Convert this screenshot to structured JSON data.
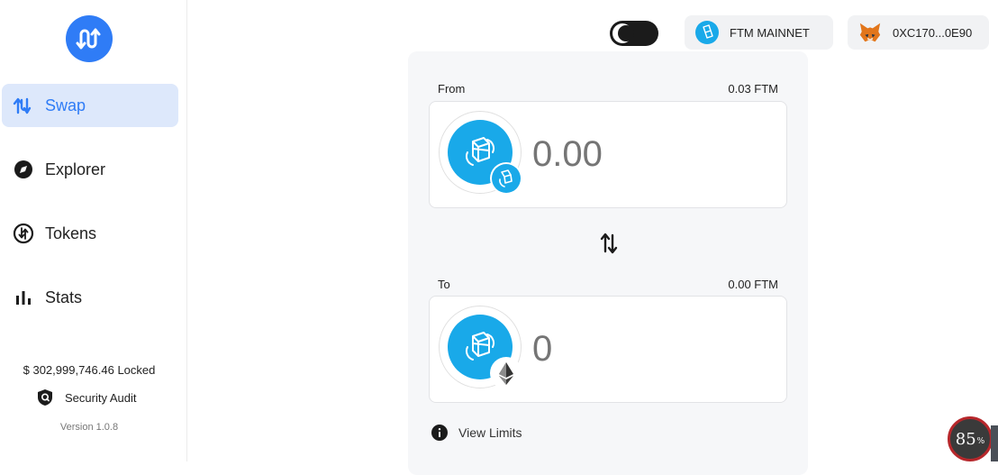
{
  "colors": {
    "accent": "#2f7cf6",
    "fantom": "#19a9e9",
    "active_bg": "#dde8fb"
  },
  "sidebar": {
    "logo_icon": "multichain-logo-icon",
    "items": [
      {
        "label": "Swap",
        "icon": "swap-arrows-icon",
        "active": true
      },
      {
        "label": "Explorer",
        "icon": "compass-icon",
        "active": false
      },
      {
        "label": "Tokens",
        "icon": "tokens-icon",
        "active": false
      },
      {
        "label": "Stats",
        "icon": "bar-chart-icon",
        "active": false
      }
    ],
    "locked": "$ 302,999,746.46 Locked",
    "audit": "Security Audit",
    "version": "Version 1.0.8"
  },
  "header": {
    "theme_toggle": "dark-mode-toggle",
    "network": "FTM MAINNET",
    "wallet": "0XC170...0E90"
  },
  "swap": {
    "from": {
      "label": "From",
      "balance": "0.03 FTM",
      "amount_placeholder": "0.00",
      "token_icon": "fantom-icon",
      "badge_icon": "fantom-icon"
    },
    "to": {
      "label": "To",
      "balance": "0.00 FTM",
      "amount_placeholder": "0",
      "token_icon": "fantom-icon",
      "badge_icon": "ethereum-icon"
    },
    "view_limits": "View Limits"
  },
  "overlay": {
    "percent": "85",
    "unit": "%"
  }
}
